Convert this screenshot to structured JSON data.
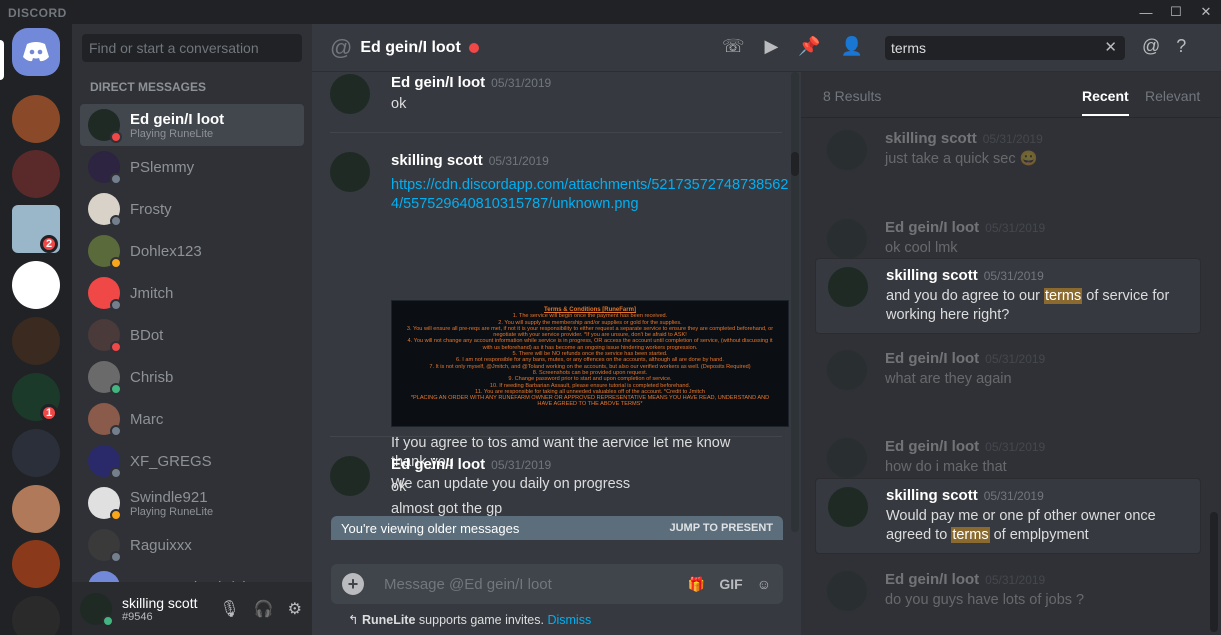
{
  "app": {
    "brand": "DISCORD",
    "accent": "#7289da"
  },
  "window": {
    "minimize": "—",
    "maximize": "☐",
    "close": "✕"
  },
  "guilds": {
    "badge_1": "2",
    "badge_2": "1"
  },
  "dm_panel": {
    "search_placeholder": "Find or start a conversation",
    "header": "Direct Messages",
    "items": [
      {
        "name": "Ed gein/I loot",
        "sub": "Playing RuneLite",
        "status": "#f04747",
        "color": "#1f2a24"
      },
      {
        "name": "PSlemmy",
        "sub": "",
        "status": "#747f8d",
        "color": "#2c2440"
      },
      {
        "name": "Frosty",
        "sub": "",
        "status": "#747f8d",
        "color": "#d8d2c8"
      },
      {
        "name": "Dohlex123",
        "sub": "",
        "status": "#faa61a",
        "color": "#5a6a3a"
      },
      {
        "name": "Jmitch",
        "sub": "",
        "status": "#747f8d",
        "color": "#f04747"
      },
      {
        "name": "BDot",
        "sub": "",
        "status": "#f04747",
        "color": "#4a3a3a"
      },
      {
        "name": "Chrisb",
        "sub": "",
        "status": "#43b581",
        "color": "#6a6a6a"
      },
      {
        "name": "Marc",
        "sub": "",
        "status": "#747f8d",
        "color": "#8a5a4a"
      },
      {
        "name": "XF_GREGS",
        "sub": "",
        "status": "#747f8d",
        "color": "#2a2a6a"
      },
      {
        "name": "Swindle921",
        "sub": "Playing RuneLite",
        "status": "#faa61a",
        "color": "#e0e0e0"
      },
      {
        "name": "Raguixxx",
        "sub": "",
        "status": "#747f8d",
        "color": "#3a3a3a"
      },
      {
        "name": "Frosty, Ed gein/I loot",
        "sub": "",
        "status": "",
        "color": "#7289da"
      }
    ],
    "user": {
      "name": "skilling scott",
      "tag": "#9546"
    }
  },
  "chat": {
    "title": "Ed gein/I loot",
    "search_value": "terms",
    "messages": [
      {
        "author": "Ed gein/I loot",
        "time": "05/31/2019",
        "lines": [
          "ok"
        ]
      },
      {
        "author": "skilling scott",
        "time": "05/31/2019",
        "link": "https://cdn.discordapp.com/attachments/521735727487385624/557529640810315787/unknown.png",
        "lines": [
          "If you agree to tos amd want the aervice let me know",
          "thank you",
          "We can update you daily on progress"
        ]
      },
      {
        "author": "Ed gein/I loot",
        "time": "05/31/2019",
        "lines": [
          "ok",
          "almost got the gp"
        ]
      }
    ],
    "embed": {
      "title": "Terms & Conditions [RuneFarm]",
      "rules": [
        "1. The service will begin once the payment has been received.",
        "2. You will supply the membership and/or supplies or gold for the supplies.",
        "3. You will ensure all pre-reqs are met, if not it is your responsibility to either request a separate service to ensure they are completed beforehand, or negotiate with your service provider. *If you are unsure, don't be afraid to ASK!",
        "4. You will not change any account information while service is in progress, OR access the account until completion of service, (without discussing it with us beforehand) as it has become an ongoing issue hindering workers progression.",
        "5. There will be NO refunds once the service has been started.",
        "6. I am not responsible for any bans, mutes, or any offences on the accounts, although all are done by hand.",
        "7. It is not only myself, @Jmitch, and @Toland working on the accounts, but also our verified workers as well. (Deposits Required)",
        "8. Screenshots can be provided upon request.",
        "9. Change password prior to start and upon completion of service.",
        "10. If needing Barbarian Assault, please ensure tutorial is completed beforehand.",
        "11. You are responsible for taking all unneeded valuables off of the account. *Credit to Jmitch",
        "*PLACING AN ORDER WITH ANY RUNEFARM OWNER OR APPROVED REPRESENTATIVE MEANS YOU HAVE READ, UNDERSTAND AND HAVE AGREED TO THE ABOVE TERMS*"
      ]
    },
    "older_text": "You're viewing older messages",
    "jump_label": "JUMP TO PRESENT",
    "composer_placeholder": "Message @Ed gein/I loot",
    "gif_label": "GIF",
    "hint_app": "RuneLite",
    "hint_text": " supports game invites. ",
    "hint_dismiss": "Dismiss"
  },
  "results": {
    "count": "8 Results",
    "tab_recent": "Recent",
    "tab_relevant": "Relevant",
    "items": [
      {
        "author": "skilling scott",
        "time": "05/31/2019",
        "pre": "just take a quick sec 😀",
        "hl": "",
        "post": "",
        "hit": false
      },
      {
        "author": "Ed gein/I loot",
        "time": "05/31/2019",
        "pre": "ok cool lmk",
        "hl": "",
        "post": "",
        "hit": false
      },
      {
        "author": "skilling scott",
        "time": "05/31/2019",
        "pre": "and you do agree to our ",
        "hl": "terms",
        "post": " of service for working here right?",
        "hit": true
      },
      {
        "author": "Ed gein/I loot",
        "time": "05/31/2019",
        "pre": "what are they again",
        "hl": "",
        "post": "",
        "hit": false
      },
      {
        "author": "Ed gein/I loot",
        "time": "05/31/2019",
        "pre": "how do i make that",
        "hl": "",
        "post": "",
        "hit": false
      },
      {
        "author": "skilling scott",
        "time": "05/31/2019",
        "pre": "Would pay me or one pf other owner once agreed to ",
        "hl": "terms",
        "post": " of emplpyment",
        "hit": true
      },
      {
        "author": "Ed gein/I loot",
        "time": "05/31/2019",
        "pre": "do you guys have lots of jobs ?",
        "hl": "",
        "post": "",
        "hit": false
      }
    ]
  }
}
